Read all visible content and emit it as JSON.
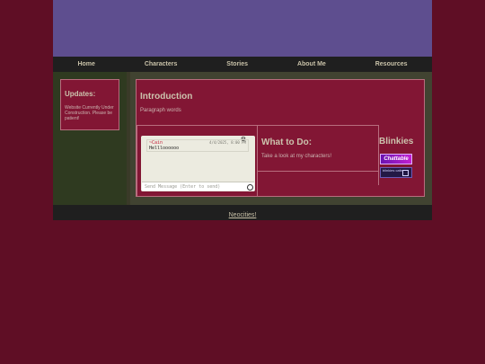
{
  "nav": {
    "items": [
      "Home",
      "Characters",
      "Stories",
      "About Me",
      "Resources"
    ]
  },
  "updates": {
    "title": "Updates:",
    "text": "Website Currently Under Construction. Please be patient!"
  },
  "intro": {
    "title": "Introduction",
    "paragraph": "Paragraph words"
  },
  "chat": {
    "username": "~Cain",
    "timestamp": "4/4/2025, 8:00 PM",
    "message": "Hellloooooo",
    "input_placeholder": "Send Message (Enter to send)"
  },
  "todo": {
    "title": "What to Do:",
    "text": "Take a look at my characters!"
  },
  "blinkies": {
    "title": "Blinkies",
    "blinkie1_label": "Chattable",
    "blinkie2_label": "blinkies cafe"
  },
  "footer": {
    "link_label": "Neocities!"
  },
  "colors": {
    "page_bg": "#5f0e25",
    "banner": "#5e4e8f",
    "panel": "#821634",
    "text_heading": "#ccc3ad"
  }
}
